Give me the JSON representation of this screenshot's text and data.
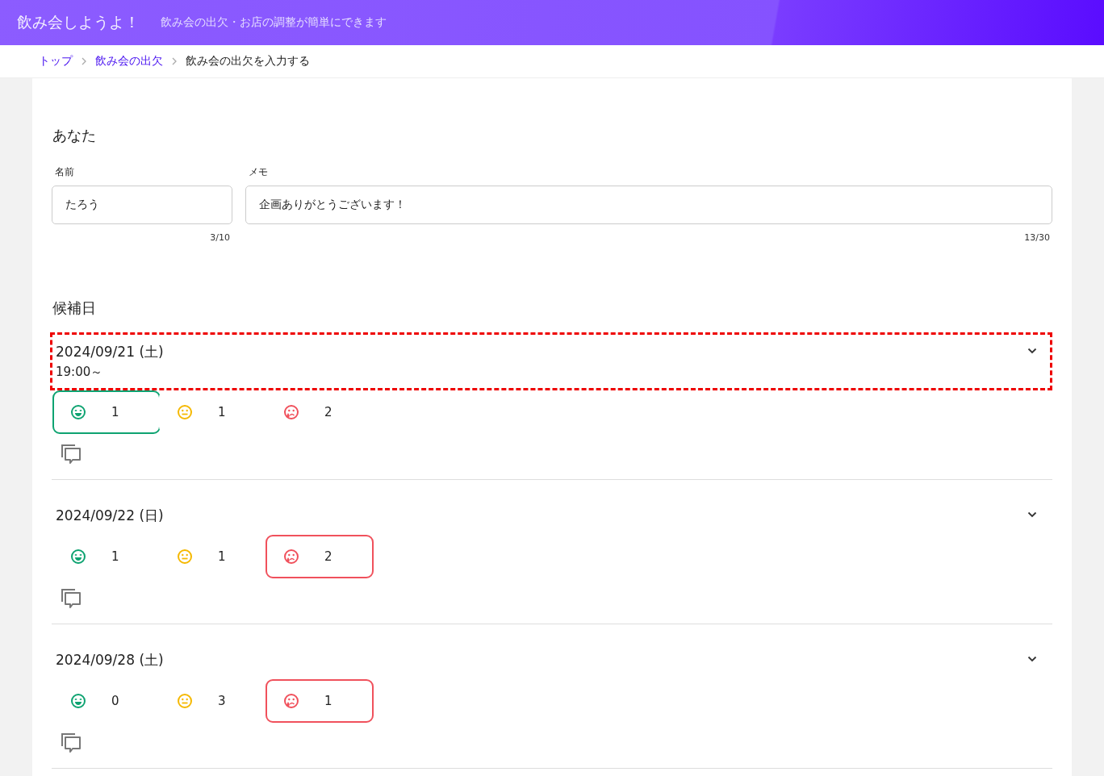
{
  "header": {
    "title": "飲み会しようよ！",
    "tagline": "飲み会の出欠・お店の調整が簡単にできます"
  },
  "breadcrumb": [
    {
      "label": "トップ",
      "link": true
    },
    {
      "label": "飲み会の出欠",
      "link": true
    },
    {
      "label": "飲み会の出欠を入力する",
      "link": false
    }
  ],
  "you": {
    "heading": "あなた",
    "fields": [
      {
        "label": "名前",
        "value": "たろう",
        "counter": "3/10"
      },
      {
        "label": "メモ",
        "value": "企画ありがとうございます！",
        "counter": "13/30"
      }
    ]
  },
  "candidates": {
    "heading": "候補日",
    "items": [
      {
        "date": "2024/09/21 (土)",
        "time": "19:00～",
        "highlighted": true,
        "votes": [
          {
            "kind": "yes",
            "count": "1",
            "selected": true
          },
          {
            "kind": "maybe",
            "count": "1",
            "selected": false
          },
          {
            "kind": "no",
            "count": "2",
            "selected": false
          }
        ]
      },
      {
        "date": "2024/09/22 (日)",
        "highlighted": false,
        "votes": [
          {
            "kind": "yes",
            "count": "1",
            "selected": false
          },
          {
            "kind": "maybe",
            "count": "1",
            "selected": false
          },
          {
            "kind": "no",
            "count": "2",
            "selected": true
          }
        ]
      },
      {
        "date": "2024/09/28 (土)",
        "highlighted": false,
        "votes": [
          {
            "kind": "yes",
            "count": "0",
            "selected": false
          },
          {
            "kind": "maybe",
            "count": "3",
            "selected": false
          },
          {
            "kind": "no",
            "count": "1",
            "selected": true
          }
        ]
      }
    ]
  }
}
